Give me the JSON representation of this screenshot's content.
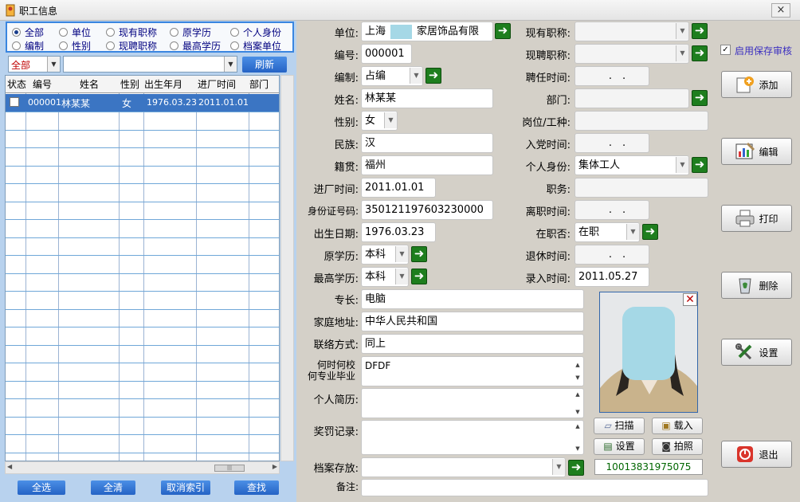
{
  "window": {
    "title": "职工信息",
    "close": "×"
  },
  "filters": {
    "options": [
      "全部",
      "单位",
      "现有职称",
      "原学历",
      "个人身份",
      "编制",
      "性别",
      "现聘职称",
      "最高学历",
      "档案单位"
    ],
    "selected": "全部",
    "combo1": "全部",
    "combo2": "",
    "refresh": "刷新"
  },
  "grid": {
    "headers": [
      "状态",
      "编号",
      "姓名",
      "性别",
      "出生年月",
      "进厂时间",
      "部门"
    ],
    "rows": [
      {
        "status_checked": false,
        "id": "000001",
        "name": "林某某",
        "gender": "女",
        "birth": "1976.03.23",
        "join": "2011.01.01",
        "dept": ""
      }
    ],
    "scroll_thumb": "|||"
  },
  "bottom_buttons": [
    "全选",
    "全清",
    "取消索引",
    "查找"
  ],
  "form": {
    "unit_label": "单位:",
    "unit_value": "上海　　　家居饰品有限",
    "id_label": "编号:",
    "id_value": "000001",
    "staffing_label": "编制:",
    "staffing_value": "占编",
    "name_label": "姓名:",
    "name_value": "林某某",
    "gender_label": "性别:",
    "gender_value": "女",
    "ethnic_label": "民族:",
    "ethnic_value": "汉",
    "native_label": "籍贯:",
    "native_value": "福州",
    "join_label": "进厂时间:",
    "join_value": "2011.01.01",
    "idcard_label": "身份证号码:",
    "idcard_value": "350121197603230000",
    "birth_label": "出生日期:",
    "birth_value": "1976.03.23",
    "orig_edu_label": "原学历:",
    "orig_edu_value": "本科",
    "top_edu_label": "最高学历:",
    "top_edu_value": "本科",
    "title_label": "现有职称:",
    "title_value": "",
    "hired_title_label": "现聘职称:",
    "hired_title_value": "",
    "hire_time_label": "聘任时间:",
    "hire_time_value": "　.　.",
    "dept_label": "部门:",
    "dept_value": "",
    "post_label": "岗位/工种:",
    "post_value": "",
    "party_label": "入党时间:",
    "party_value": "　.　.",
    "identity_label": "个人身份:",
    "identity_value": "集体工人",
    "duty_label": "职务:",
    "duty_value": "",
    "leave_label": "离职时间:",
    "leave_value": "　.　.",
    "onjob_label": "在职否:",
    "onjob_value": "在职",
    "retire_label": "退休时间:",
    "retire_value": "　.　.",
    "entry_label": "录入时间:",
    "entry_value": "2011.05.27",
    "specialty_label": "专长:",
    "specialty_value": "电脑",
    "address_label": "家庭地址:",
    "address_value": "中华人民共和国",
    "contact_label": "联络方式:",
    "contact_value": "同上",
    "school_label_1": "何时何校",
    "school_label_2": "何专业毕业",
    "school_value": "DFDF",
    "resume_label": "个人简历:",
    "resume_value": "",
    "reward_label": "奖罚记录:",
    "reward_value": "",
    "archive_label": "档案存放:",
    "archive_value": "",
    "remark_label": "备注:",
    "remark_value": "",
    "phone": "10013831975075"
  },
  "photo_buttons": {
    "scan": "扫描",
    "load": "载入",
    "settings": "设置",
    "shoot": "拍照"
  },
  "right_panel": {
    "audit_label": "启用保存审核",
    "audit_checked": true,
    "add": "添加",
    "edit": "编辑",
    "print": "打印",
    "delete": "删除",
    "settings": "设置",
    "exit": "退出"
  },
  "colors": {
    "grid_selection": "#3b75c3",
    "button_blue": "#2563c5",
    "go_green": "#1e7e1e",
    "redaction": "#a5d8e6"
  }
}
